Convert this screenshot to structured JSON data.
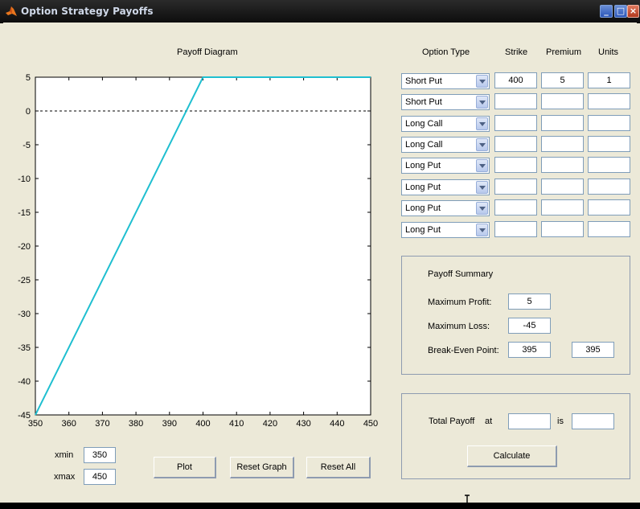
{
  "window": {
    "title": "Option Strategy Payoffs"
  },
  "plot": {
    "title": "Payoff Diagram"
  },
  "chart_data": {
    "type": "line",
    "title": "Payoff Diagram",
    "xlabel": "",
    "ylabel": "",
    "xlim": [
      350,
      450
    ],
    "ylim": [
      -45,
      5
    ],
    "xticks": [
      "350",
      "360",
      "370",
      "380",
      "390",
      "400",
      "410",
      "420",
      "430",
      "440",
      "450"
    ],
    "yticks": [
      "5",
      "0",
      "-5",
      "-10",
      "-15",
      "-20",
      "-25",
      "-30",
      "-35",
      "-40",
      "-45"
    ],
    "zero_line": true,
    "series": [
      {
        "color": "#1fbfd0",
        "x": [
          350,
          400,
          450
        ],
        "y": [
          -45,
          5,
          5
        ]
      }
    ]
  },
  "range": {
    "xmin_label": "xmin",
    "xmin_value": "350",
    "xmax_label": "xmax",
    "xmax_value": "450"
  },
  "buttons": {
    "plot": "Plot",
    "reset_graph": "Reset Graph",
    "reset_all": "Reset All",
    "calculate": "Calculate"
  },
  "table": {
    "headers": {
      "option_type": "Option Type",
      "strike": "Strike",
      "premium": "Premium",
      "units": "Units"
    },
    "rows": [
      {
        "type": "Short Put",
        "strike": "400",
        "premium": "5",
        "units": "1"
      },
      {
        "type": "Short Put",
        "strike": "",
        "premium": "",
        "units": ""
      },
      {
        "type": "Long Call",
        "strike": "",
        "premium": "",
        "units": ""
      },
      {
        "type": "Long Call",
        "strike": "",
        "premium": "",
        "units": ""
      },
      {
        "type": "Long Put",
        "strike": "",
        "premium": "",
        "units": ""
      },
      {
        "type": "Long Put",
        "strike": "",
        "premium": "",
        "units": ""
      },
      {
        "type": "Long Put",
        "strike": "",
        "premium": "",
        "units": ""
      },
      {
        "type": "Long Put",
        "strike": "",
        "premium": "",
        "units": ""
      }
    ]
  },
  "summary": {
    "title": "Payoff Summary",
    "max_profit_label": "Maximum Profit:",
    "max_profit": "5",
    "max_loss_label": "Maximum Loss:",
    "max_loss": "-45",
    "break_even_label": "Break-Even Point:",
    "break_even_1": "395",
    "break_even_2": "395"
  },
  "total": {
    "label": "Total Payoff",
    "at_label": "at",
    "at_value": "",
    "is_label": "is",
    "is_value": ""
  }
}
